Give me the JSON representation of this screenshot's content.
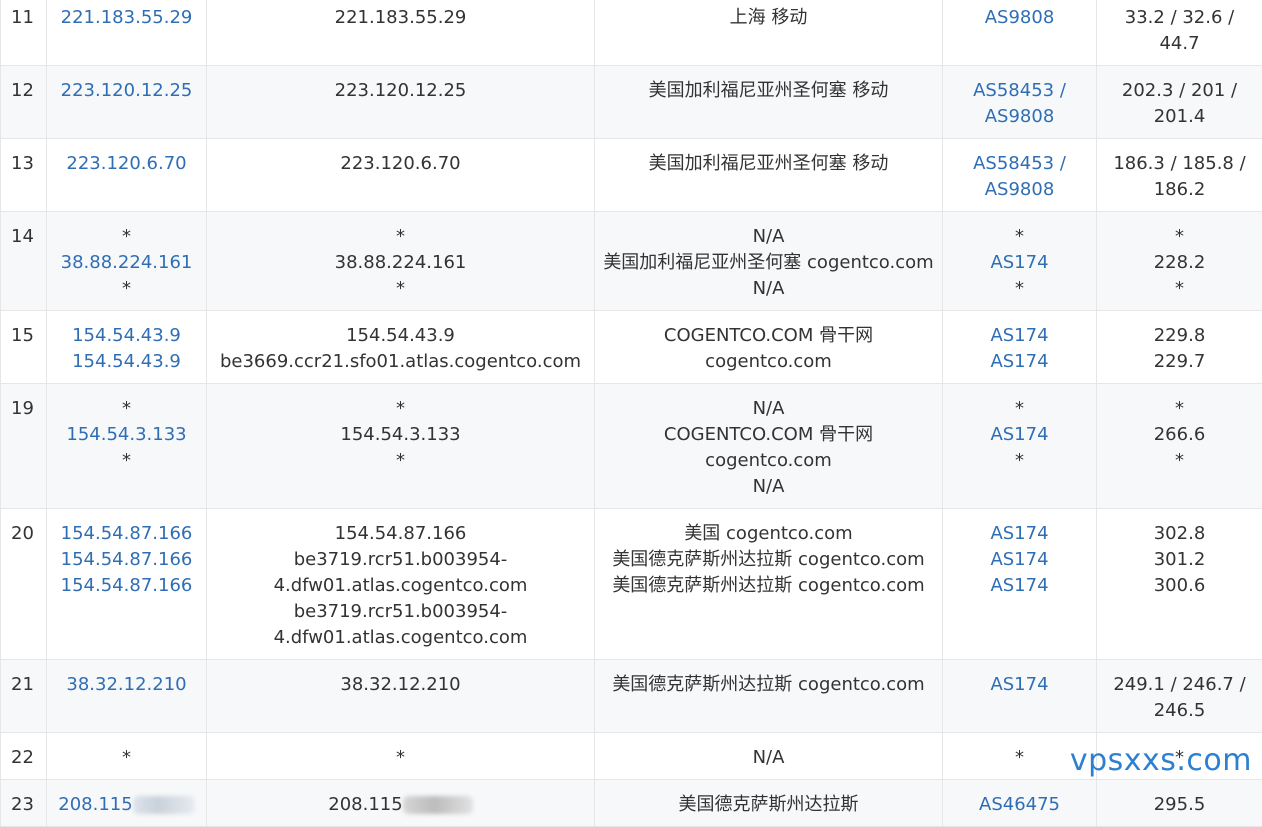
{
  "rows": [
    {
      "hop": "11",
      "ip": [
        "221.183.55.29"
      ],
      "host": [
        "221.183.55.29"
      ],
      "location": [
        "上海 移动"
      ],
      "asn": [
        "AS9808"
      ],
      "rtt": [
        "33.2 / 32.6 / 44.7"
      ]
    },
    {
      "hop": "12",
      "ip": [
        "223.120.12.25"
      ],
      "host": [
        "223.120.12.25"
      ],
      "location": [
        "美国加利福尼亚州圣何塞 移动"
      ],
      "asn": [
        "AS58453 / AS9808"
      ],
      "rtt": [
        "202.3 / 201 / 201.4"
      ]
    },
    {
      "hop": "13",
      "ip": [
        "223.120.6.70"
      ],
      "host": [
        "223.120.6.70"
      ],
      "location": [
        "美国加利福尼亚州圣何塞 移动"
      ],
      "asn": [
        "AS58453 / AS9808"
      ],
      "rtt": [
        "186.3 / 185.8 / 186.2"
      ]
    },
    {
      "hop": "14",
      "ip": [
        "*",
        "38.88.224.161",
        "*"
      ],
      "host": [
        "*",
        "38.88.224.161",
        "*"
      ],
      "location": [
        "N/A",
        "美国加利福尼亚州圣何塞 cogentco.com",
        "N/A"
      ],
      "asn": [
        "*",
        "AS174",
        "*"
      ],
      "rtt": [
        "*",
        "228.2",
        "*"
      ]
    },
    {
      "hop": "15",
      "ip": [
        "154.54.43.9",
        "154.54.43.9"
      ],
      "host": [
        "154.54.43.9",
        "be3669.ccr21.sfo01.atlas.cogentco.com"
      ],
      "location": [
        "COGENTCO.COM 骨干网",
        "cogentco.com"
      ],
      "asn": [
        "AS174",
        "AS174"
      ],
      "rtt": [
        "229.8",
        "229.7"
      ]
    },
    {
      "hop": "19",
      "ip": [
        "*",
        "154.54.3.133",
        "*"
      ],
      "host": [
        "*",
        "154.54.3.133",
        "*"
      ],
      "location": [
        "N/A",
        "COGENTCO.COM 骨干网",
        "cogentco.com",
        "N/A"
      ],
      "asn": [
        "*",
        "AS174",
        "*"
      ],
      "rtt": [
        "*",
        "266.6",
        "*"
      ]
    },
    {
      "hop": "20",
      "ip": [
        "154.54.87.166",
        "154.54.87.166",
        "154.54.87.166"
      ],
      "host": [
        "154.54.87.166",
        "be3719.rcr51.b003954-4.dfw01.atlas.cogentco.com",
        "be3719.rcr51.b003954-4.dfw01.atlas.cogentco.com"
      ],
      "location": [
        "美国 cogentco.com",
        "美国德克萨斯州达拉斯 cogentco.com",
        "美国德克萨斯州达拉斯 cogentco.com"
      ],
      "asn": [
        "AS174",
        "AS174",
        "AS174"
      ],
      "rtt": [
        "302.8",
        "301.2",
        "300.6"
      ]
    },
    {
      "hop": "21",
      "ip": [
        "38.32.12.210"
      ],
      "host": [
        "38.32.12.210"
      ],
      "location": [
        "美国德克萨斯州达拉斯 cogentco.com"
      ],
      "asn": [
        "AS174"
      ],
      "rtt": [
        "249.1 / 246.7 / 246.5"
      ]
    },
    {
      "hop": "22",
      "ip": [
        "*"
      ],
      "host": [
        "*"
      ],
      "location": [
        "N/A"
      ],
      "asn": [
        "*"
      ],
      "rtt": [
        "*"
      ]
    },
    {
      "hop": "23",
      "ip": [
        "208.115"
      ],
      "host": [
        "208.115"
      ],
      "location": [
        "美国德克萨斯州达拉斯"
      ],
      "asn": [
        "AS46475"
      ],
      "rtt": [
        "295.5"
      ]
    }
  ],
  "watermark": "vpsxxs.com",
  "colors": {
    "link": "#2f6eb5",
    "border": "#e6e6e6",
    "alt_row": "#f7f8fa",
    "watermark": "#2d7fd0"
  }
}
